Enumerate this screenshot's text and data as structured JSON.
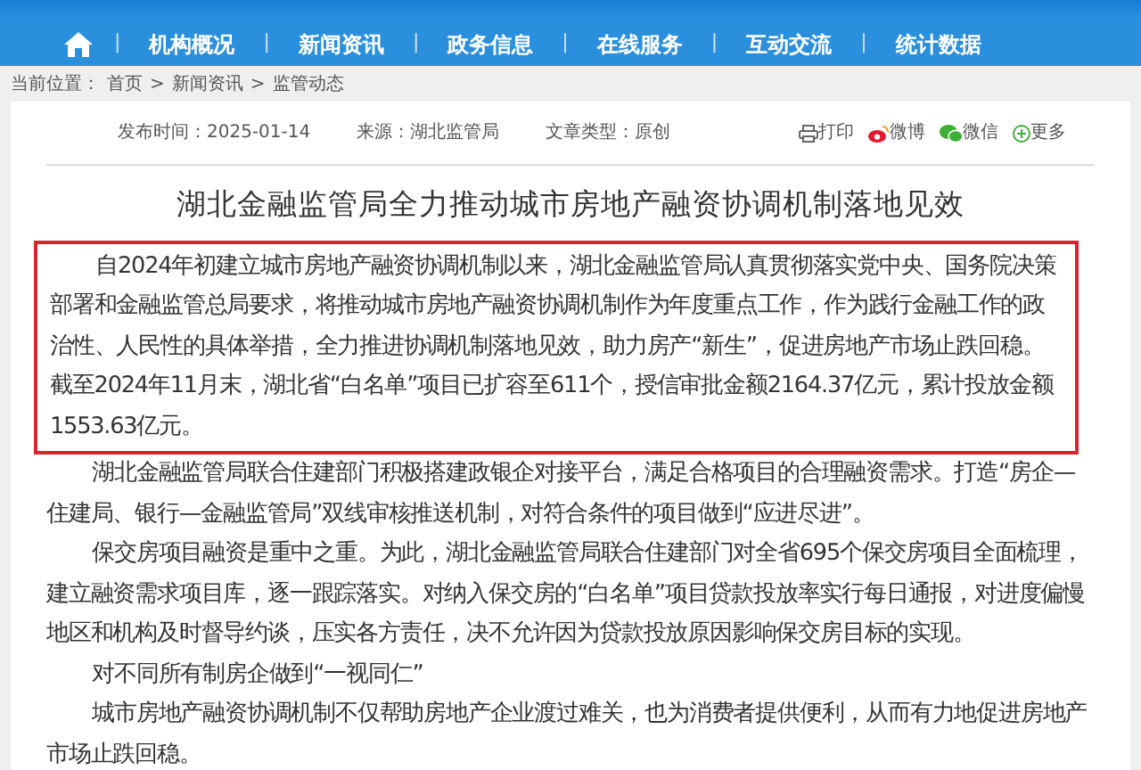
{
  "nav": {
    "separator": "|",
    "items": [
      "机构概况",
      "新闻资讯",
      "政务信息",
      "在线服务",
      "互动交流",
      "统计数据"
    ]
  },
  "breadcrumb": {
    "label": "当前位置：",
    "items": [
      "首页",
      "新闻资讯",
      "监管动态"
    ],
    "separator": ">"
  },
  "meta": {
    "items": [
      "发布时间：2025-01-14",
      "来源：湖北监管局",
      "文章类型：原创"
    ]
  },
  "share": [
    {
      "kind": "print",
      "label": "打印"
    },
    {
      "kind": "weibo",
      "label": "微博"
    },
    {
      "kind": "wechat",
      "label": "微信"
    },
    {
      "kind": "more",
      "label": "更多"
    }
  ],
  "article": {
    "title": "湖北金融监管局全力推动城市房地产融资协调机制落地见效",
    "paragraphs": [
      {
        "text": "自2024年初建立城市房地产融资协调机制以来，湖北金融监管局认真贯彻落实党中央、国务院决策部署和金融监管总局要求，将推动城市房地产融资协调机制作为年度重点工作，作为践行金融工作的政治性、人民性的具体举措，全力推进协调机制落地见效，助力房产“新生”，促进房地产市场止跌回稳。截至2024年11月末，湖北省“白名单”项目已扩容至611个，授信审批金额2164.37亿元，累计投放金额1553.63亿元。",
        "highlighted": true
      },
      {
        "text": "湖北金融监管局联合住建部门积极搭建政银企对接平台，满足合格项目的合理融资需求。打造“房企—住建局、银行—金融监管局”双线审核推送机制，对符合条件的项目做到“应进尽进”。",
        "highlighted": false
      },
      {
        "text": "保交房项目融资是重中之重。为此，湖北金融监管局联合住建部门对全省695个保交房项目全面梳理，建立融资需求项目库，逐一跟踪落实。对纳入保交房的“白名单”项目贷款投放率实行每日通报，对进度偏慢地区和机构及时督导约谈，压实各方责任，决不允许因为贷款投放原因影响保交房目标的实现。",
        "highlighted": false
      },
      {
        "text": "对不同所有制房企做到“一视同仁”",
        "highlighted": false
      },
      {
        "text": "城市房地产融资协调机制不仅帮助房地产企业渡过难关，也为消费者提供便利，从而有力地促进房地产市场止跌回稳。",
        "highlighted": false
      }
    ]
  }
}
